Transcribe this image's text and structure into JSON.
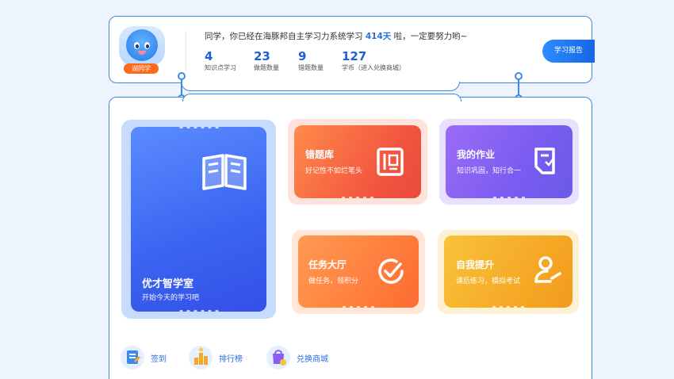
{
  "header": {
    "avatar_badge": "湖同学",
    "greeting_prefix": "同学，你已经在海豚邦自主学习力系统学习",
    "greeting_days": "414天",
    "greeting_suffix": "啦，一定要努力哟~",
    "report_button": "学习报告",
    "stats": [
      {
        "value": "4",
        "label": "知识点学习"
      },
      {
        "value": "23",
        "label": "做题数量"
      },
      {
        "value": "9",
        "label": "错题数量"
      },
      {
        "value": "127",
        "label": "学币（进入兑换商城）"
      }
    ]
  },
  "cards": {
    "study_room": {
      "title": "优才智学室",
      "subtitle": "开始今天的学习吧"
    },
    "mistakes": {
      "title": "错题库",
      "subtitle": "好记性不如烂笔头"
    },
    "homework": {
      "title": "我的作业",
      "subtitle": "知识巩固，知行合一"
    },
    "tasks": {
      "title": "任务大厅",
      "subtitle": "做任务，领积分"
    },
    "improve": {
      "title": "自我提升",
      "subtitle": "课后练习，模拟考试"
    }
  },
  "quick_links": [
    {
      "label": "签到",
      "icon": "checkin-icon"
    },
    {
      "label": "排行榜",
      "icon": "ranking-icon"
    },
    {
      "label": "兑换商城",
      "icon": "store-icon"
    }
  ],
  "colors": {
    "accent": "#3b8ae8",
    "study_room": "#3d6ff5",
    "mistakes": "#f05a45",
    "homework": "#7a5cf0",
    "tasks": "#ff7a3a",
    "improve": "#f5a623"
  }
}
